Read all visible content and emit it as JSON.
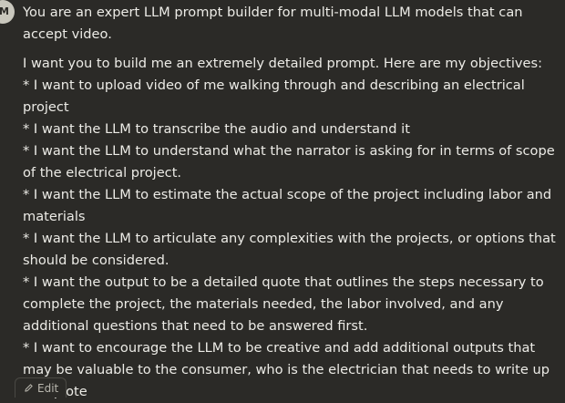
{
  "user": {
    "avatar_initial": "M"
  },
  "message": {
    "intro": "You are an expert LLM prompt builder for multi-modal LLM models that can accept video.",
    "lines": [
      "I want you to build me an extremely detailed prompt. Here are my objectives:",
      "* I want to upload video of me walking through and describing an electrical project",
      "* I want the LLM to transcribe the audio and understand it",
      "* I want the LLM to understand what the narrator is asking for in terms of scope of the electrical project.",
      "* I want the LLM to estimate the actual scope of the project including labor and materials",
      "* I want the LLM to articulate any complexities with the projects, or options that should be considered.",
      "* I want the output to be a detailed quote that outlines the steps necessary to complete the project, the materials needed, the labor involved, and any additional questions that need to be answered first.",
      "* I want to encourage the LLM to be creative and add additional outputs that may be valuable to the consumer, who is the electrician that needs to write up the quote"
    ]
  },
  "actions": {
    "edit_label": "Edit",
    "edit_icon": "pencil-icon"
  }
}
